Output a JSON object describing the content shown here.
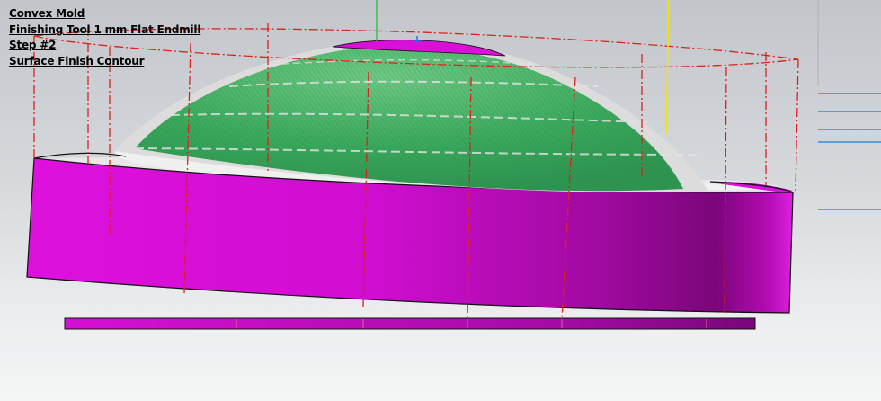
{
  "caption": {
    "line1": "Convex Mold",
    "line2": "Finishing Tool 1 mm Flat Endmill",
    "line3": "Step #2",
    "line4": "Surface Finish Contour"
  },
  "colors": {
    "magenta": "#d810d8",
    "toolpath_green": "#2ea860",
    "boundary_red": "#e0201a",
    "axis_blue": "#1a7ae0",
    "axis_yellow": "#f2e400",
    "axis_green": "#19c02a"
  }
}
